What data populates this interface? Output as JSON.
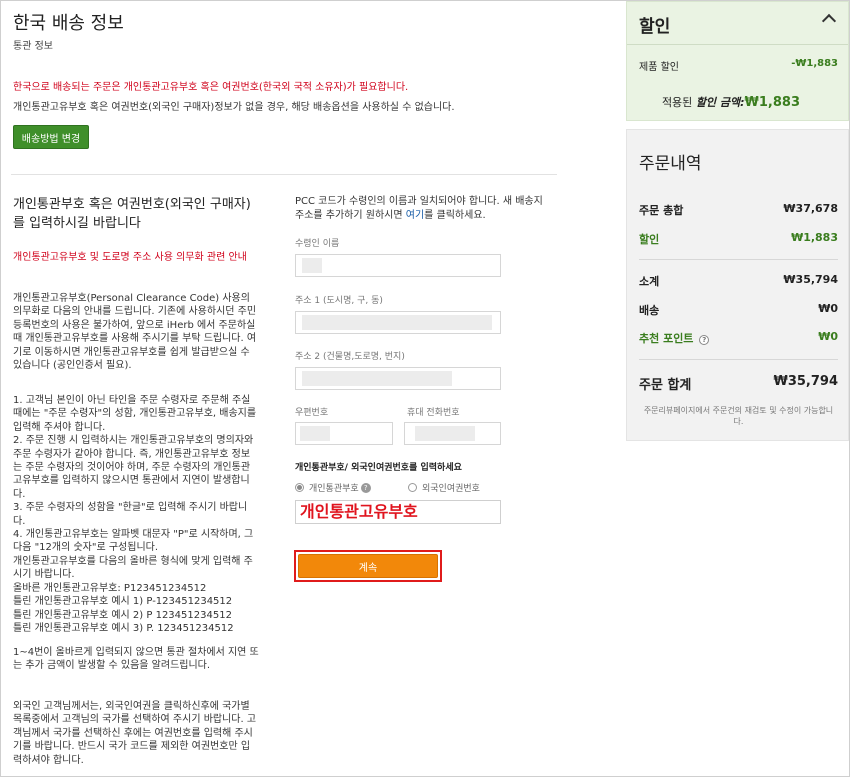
{
  "header": {
    "title": "한국 배송 정보",
    "subtitle": "통관 정보",
    "notice_red": "한국으로 배송되는 주문은 개인통관고유부호 혹은 여권번호(한국외 국적 소유자)가 필요합니다.",
    "notice_black": "개인통관고유부호 혹은 여권번호(외국인 구매자)정보가 없을 경우, 해당 배송옵션을 사용하실 수 없습니다.",
    "change_button": "배송방법 변경"
  },
  "left": {
    "heading": "개인통관부호 혹은 여권번호(외국인 구매자)를 입력하시길 바랍니다",
    "guide_link": "개인통관고유부호 및 도로명 주소 사용 의무화 관련 안내",
    "para1": "개인통관고유부호(Personal Clearance Code) 사용의 의무화로 다음의 안내를 드립니다. 기존에 사용하시던 주민등록번호의 사용은 불가하여, 앞으로 iHerb 에서 주문하실 때 개인통관고유부호를 사용해 주시기를 부탁 드립니다. 여기로 이동하시면 개인통관고유부호를 쉽게 발급받으실 수 있습니다 (공인인증서 필요).",
    "para2": "1. 고객님 본인이 아닌 타인을 주문 수령자로 주문해 주실 때에는 \"주문 수령자\"의 성함, 개인통관고유부호, 배송지를 입력해 주셔야 합니다.\n2. 주문 진행 시 입력하시는 개인통관고유부호의 명의자와 주문 수령자가 같아야 합니다. 즉, 개인통관고유부호 정보는 주문 수령자의 것이어야 하며, 주문 수령자의 개인통관고유부호를 입력하지 않으시면 통관에서 지연이 발생합니다.\n3. 주문 수령자의 성함을 \"한글\"로 입력해 주시기 바랍니다.\n4. 개인통관고유부호는 알파벳 대문자 \"P\"로 시작하며, 그 다음 \"12개의 숫자\"로 구성됩니다.\n개인통관고유부호를 다음의 올바른 형식에 맞게 입력해 주시기 바랍니다.\n올바른 개인통관고유부호: P123451234512\n틀린 개인통관고유부호 예시 1) P-123451234512\n틀린 개인통관고유부호 예시 2) P 123451234512\n틀린 개인통관고유부호 예시 3) P. 123451234512",
    "para3": "1~4번이 올바르게 입력되지 않으면 통관 절차에서 지연 또는 추가 금액이 발생할 수 있음을 알려드립니다.",
    "para4": "외국인 고객님께서는, 외국인여권을 클릭하신후에 국가별 목록중에서 고객님의 국가를 선택하여 주시기 바랍니다. 고객님께서 국가를 선택하신 후에는 여권번호를 입력해 주시기를 바랍니다. 반드시 국가 코드를 제외한 여권번호만 입력하셔야 합니다."
  },
  "form": {
    "pcc_note_1": "PCC 코드가 수령인의 이름과 일치되어야 합니다. 새 배송지 주소를 추가하기 원하시면 ",
    "pcc_note_link": "여기",
    "pcc_note_2": "를 클릭하세요.",
    "recipient_label": "수령인 이름",
    "addr1_label": "주소 1 (도시명, 구, 동)",
    "addr2_label": "주소 2 (건물명,도로명, 번지)",
    "postal_label": "우편번호",
    "phone_label": "휴대 전화번호",
    "id_title": "개인통관부호/ 외국인여권번호를 입력하세요",
    "radio_pcc": "개인통관부호",
    "radio_passport": "외국인여권번호",
    "pcc_value": "개인통관고유부호",
    "continue_button": "계속"
  },
  "discount": {
    "title": "할인",
    "product_label": "제품 할인",
    "product_amount": "-₩1,883",
    "applied_label": "적용된",
    "applied_italic": "할인 금액:",
    "applied_amount": "₩1,883"
  },
  "order": {
    "title": "주문내역",
    "rows": [
      {
        "label": "주문 총합",
        "value": "₩37,678"
      },
      {
        "label": "할인",
        "value": "₩1,883"
      },
      {
        "label": "소계",
        "value": "₩35,794"
      },
      {
        "label": "배송",
        "value": "₩0"
      },
      {
        "label": "추천 포인트",
        "value": "₩0"
      }
    ],
    "total_label": "주문 합계",
    "total_value": "₩35,794",
    "footnote": "주문리뷰페이지에서 주문건의 재검토 및 수정이 가능합니다."
  },
  "colors": {
    "accent_green": "#3f8f2a",
    "continue_orange": "#f2880a",
    "alert_red": "#d0021b"
  }
}
